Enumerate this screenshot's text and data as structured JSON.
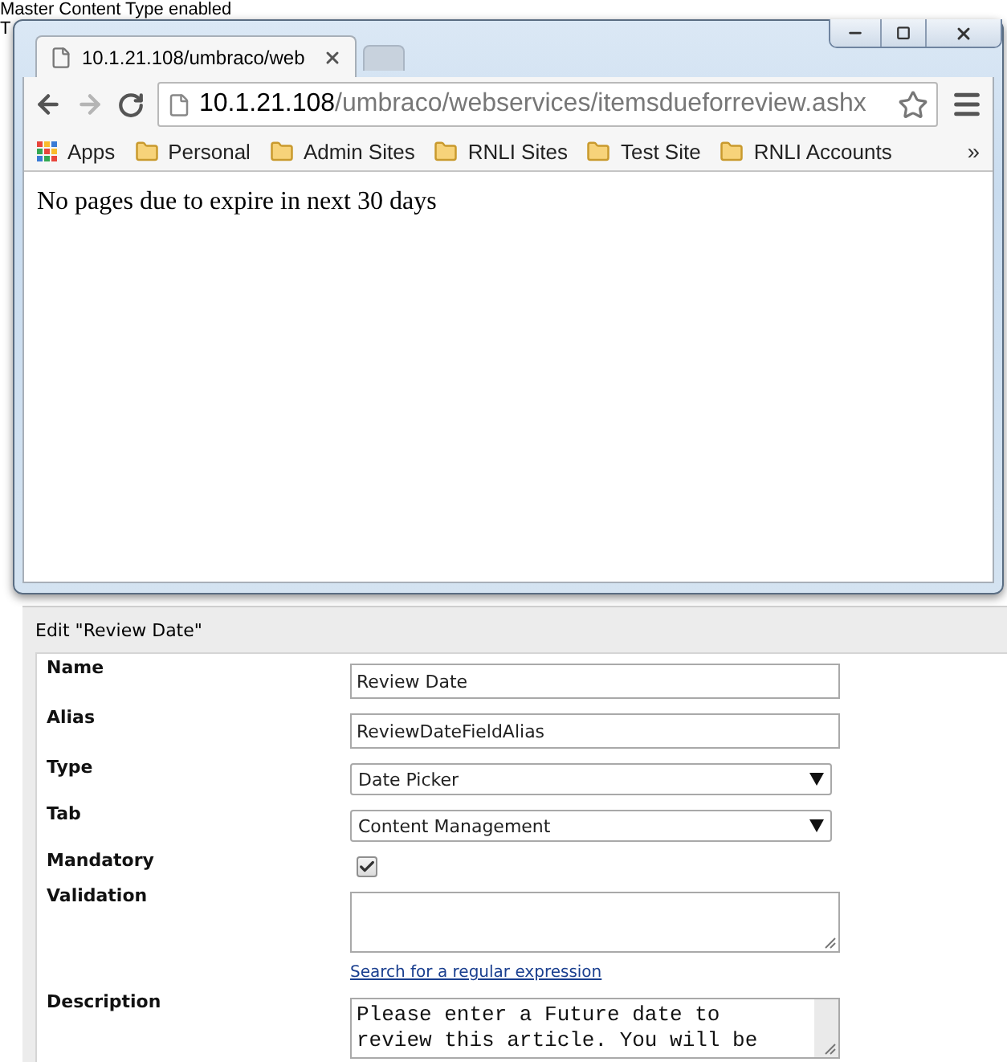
{
  "background_page": {
    "lines": [
      "Master Content Type enabled",
      "T"
    ]
  },
  "browser": {
    "tabs": [
      {
        "title": "10.1.21.108/umbraco/web",
        "selected": true
      },
      {
        "selected": false
      }
    ],
    "forward_disabled": true,
    "url": {
      "host": "10.1.21.108",
      "path": "/umbraco/webservices/itemsdueforreview.ashx"
    },
    "bookmarks": [
      {
        "label": "Apps",
        "kind": "apps"
      },
      {
        "label": "Personal",
        "kind": "folder"
      },
      {
        "label": "Admin Sites",
        "kind": "folder"
      },
      {
        "label": "RNLI Sites",
        "kind": "folder"
      },
      {
        "label": "Test Site",
        "kind": "folder"
      },
      {
        "label": "RNLI Accounts",
        "kind": "folder"
      }
    ],
    "bookmarks_overflow": "»",
    "page_text": "No pages due to expire in next 30 days"
  },
  "edit_panel": {
    "title": "Edit \"Review Date\"",
    "fields": [
      {
        "label": "Name",
        "kind": "text",
        "value": "Review Date"
      },
      {
        "label": "Alias",
        "kind": "text",
        "value": "ReviewDateFieldAlias"
      },
      {
        "label": "Type",
        "kind": "select",
        "value": "Date Picker"
      },
      {
        "label": "Tab",
        "kind": "select",
        "value": "Content Management"
      },
      {
        "label": "Mandatory",
        "kind": "checkbox",
        "checked": true
      },
      {
        "label": "Validation",
        "kind": "textarea",
        "link": "Search for a regular expression"
      },
      {
        "label": "Description",
        "kind": "textarea",
        "value": "Please enter a Future date to review this article. You will be"
      }
    ]
  }
}
